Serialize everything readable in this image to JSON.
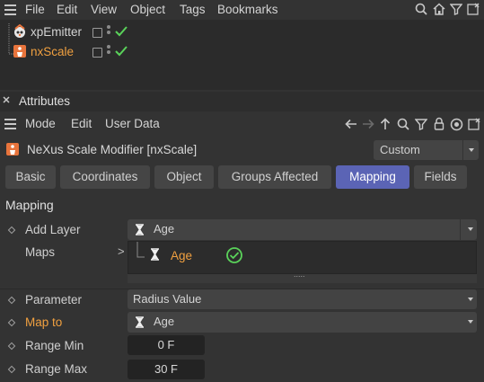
{
  "object_manager": {
    "menu": [
      "File",
      "Edit",
      "View",
      "Object",
      "Tags",
      "Bookmarks"
    ],
    "objects": [
      {
        "name": "xpEmitter",
        "selected": false,
        "color": "#d4d4d4"
      },
      {
        "name": "nxScale",
        "selected": true,
        "color": "#f0a040"
      }
    ]
  },
  "attributes": {
    "title": "Attributes",
    "menu": [
      "Mode",
      "Edit",
      "User Data"
    ],
    "object_name": "NeXus Scale Modifier [nxScale]",
    "layout_mode": "Custom",
    "tabs": [
      {
        "label": "Basic",
        "active": false
      },
      {
        "label": "Coordinates",
        "active": false
      },
      {
        "label": "Object",
        "active": false
      },
      {
        "label": "Groups Affected",
        "active": false
      },
      {
        "label": "Mapping",
        "active": true
      },
      {
        "label": "Fields",
        "active": false
      }
    ],
    "section_title": "Mapping",
    "add_layer": {
      "label": "Add Layer",
      "value": "Age"
    },
    "maps": {
      "label": "Maps",
      "expand_glyph": ">",
      "items": [
        {
          "name": "Age",
          "enabled": true
        }
      ],
      "splitter_glyph": "....."
    },
    "parameter": {
      "label": "Parameter",
      "value": "Radius Value"
    },
    "map_to": {
      "label": "Map to",
      "value": "Age"
    },
    "range_min": {
      "label": "Range Min",
      "value": "0 F"
    },
    "range_max": {
      "label": "Range Max",
      "value": "30 F"
    }
  },
  "colors": {
    "accent": "#5b64b5",
    "highlight_label": "#f0a040",
    "check_green": "#5ad25a",
    "nexus_icon": "#e8743c"
  }
}
